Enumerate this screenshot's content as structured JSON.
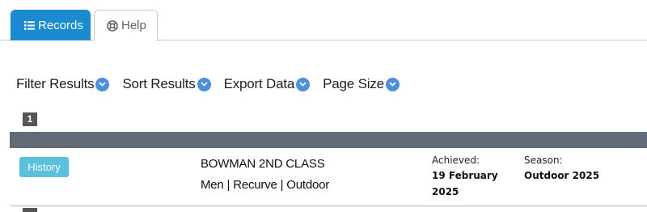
{
  "tabs": [
    {
      "label": "Records",
      "icon": "list-icon",
      "active": true
    },
    {
      "label": "Help",
      "icon": "lifebuoy-icon",
      "active": false
    }
  ],
  "filters": [
    {
      "label": "Filter Results",
      "icon": "chevron-down-icon"
    },
    {
      "label": "Sort Results",
      "icon": "chevron-down-icon"
    },
    {
      "label": "Export Data",
      "icon": "chevron-down-icon"
    },
    {
      "label": "Page Size",
      "icon": "chevron-down-icon"
    }
  ],
  "pagination": {
    "current": "1"
  },
  "record": {
    "history_label": "History",
    "title": "BOWMAN 2ND CLASS",
    "subtitle": "Men | Recurve | Outdoor",
    "achieved_label": "Achieved:",
    "achieved_value": "19 February 2025",
    "season_label": "Season:",
    "season_value": "Outdoor 2025"
  },
  "colors": {
    "accent": "#1a8ad1",
    "chevron": "#4a90e2",
    "history_button": "#5bc0de",
    "table_header": "#626a78",
    "page_badge": "#555555"
  }
}
